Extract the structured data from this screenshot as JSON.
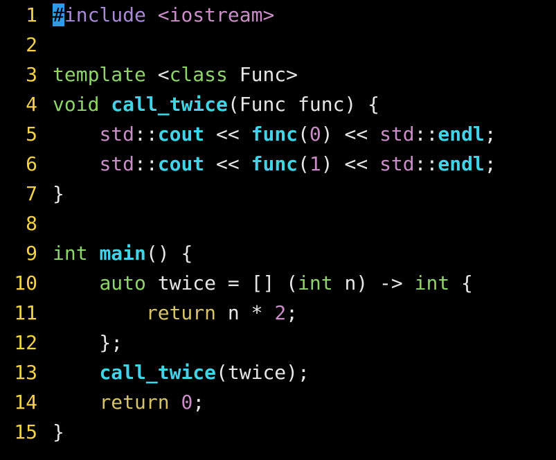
{
  "editor": {
    "lines": [
      {
        "number": "1",
        "tokens": [
          {
            "text": "#",
            "cls": "cursor"
          },
          {
            "text": "include",
            "cls": "pre"
          },
          {
            "text": " ",
            "cls": "punct"
          },
          {
            "text": "<iostream>",
            "cls": "str"
          }
        ]
      },
      {
        "number": "2",
        "tokens": []
      },
      {
        "number": "3",
        "tokens": [
          {
            "text": "template",
            "cls": "type"
          },
          {
            "text": " <",
            "cls": "punct"
          },
          {
            "text": "class",
            "cls": "type"
          },
          {
            "text": " Func>",
            "cls": "punct"
          }
        ]
      },
      {
        "number": "4",
        "tokens": [
          {
            "text": "void",
            "cls": "type"
          },
          {
            "text": " ",
            "cls": "punct"
          },
          {
            "text": "call_twice",
            "cls": "fn"
          },
          {
            "text": "(Func func) {",
            "cls": "punct"
          }
        ]
      },
      {
        "number": "5",
        "tokens": [
          {
            "text": "    ",
            "cls": "punct"
          },
          {
            "text": "std",
            "cls": "ns"
          },
          {
            "text": "::",
            "cls": "punct"
          },
          {
            "text": "cout",
            "cls": "fn"
          },
          {
            "text": " << ",
            "cls": "punct"
          },
          {
            "text": "func",
            "cls": "fn"
          },
          {
            "text": "(",
            "cls": "punct"
          },
          {
            "text": "0",
            "cls": "num"
          },
          {
            "text": ") << ",
            "cls": "punct"
          },
          {
            "text": "std",
            "cls": "ns"
          },
          {
            "text": "::",
            "cls": "punct"
          },
          {
            "text": "endl",
            "cls": "fn"
          },
          {
            "text": ";",
            "cls": "punct"
          }
        ]
      },
      {
        "number": "6",
        "tokens": [
          {
            "text": "    ",
            "cls": "punct"
          },
          {
            "text": "std",
            "cls": "ns"
          },
          {
            "text": "::",
            "cls": "punct"
          },
          {
            "text": "cout",
            "cls": "fn"
          },
          {
            "text": " << ",
            "cls": "punct"
          },
          {
            "text": "func",
            "cls": "fn"
          },
          {
            "text": "(",
            "cls": "punct"
          },
          {
            "text": "1",
            "cls": "num"
          },
          {
            "text": ") << ",
            "cls": "punct"
          },
          {
            "text": "std",
            "cls": "ns"
          },
          {
            "text": "::",
            "cls": "punct"
          },
          {
            "text": "endl",
            "cls": "fn"
          },
          {
            "text": ";",
            "cls": "punct"
          }
        ]
      },
      {
        "number": "7",
        "tokens": [
          {
            "text": "}",
            "cls": "punct"
          }
        ]
      },
      {
        "number": "8",
        "tokens": []
      },
      {
        "number": "9",
        "tokens": [
          {
            "text": "int",
            "cls": "type"
          },
          {
            "text": " ",
            "cls": "punct"
          },
          {
            "text": "main",
            "cls": "fn"
          },
          {
            "text": "() {",
            "cls": "punct"
          }
        ]
      },
      {
        "number": "10",
        "tokens": [
          {
            "text": "    ",
            "cls": "punct"
          },
          {
            "text": "auto",
            "cls": "type"
          },
          {
            "text": " twice = [] (",
            "cls": "punct"
          },
          {
            "text": "int",
            "cls": "type"
          },
          {
            "text": " n) -> ",
            "cls": "punct"
          },
          {
            "text": "int",
            "cls": "type"
          },
          {
            "text": " {",
            "cls": "punct"
          }
        ]
      },
      {
        "number": "11",
        "tokens": [
          {
            "text": "        ",
            "cls": "punct"
          },
          {
            "text": "return",
            "cls": "kw"
          },
          {
            "text": " n * ",
            "cls": "punct"
          },
          {
            "text": "2",
            "cls": "num"
          },
          {
            "text": ";",
            "cls": "punct"
          }
        ]
      },
      {
        "number": "12",
        "tokens": [
          {
            "text": "    };",
            "cls": "punct"
          }
        ]
      },
      {
        "number": "13",
        "tokens": [
          {
            "text": "    ",
            "cls": "punct"
          },
          {
            "text": "call_twice",
            "cls": "fn"
          },
          {
            "text": "(twice);",
            "cls": "punct"
          }
        ]
      },
      {
        "number": "14",
        "tokens": [
          {
            "text": "    ",
            "cls": "punct"
          },
          {
            "text": "return",
            "cls": "kw"
          },
          {
            "text": " ",
            "cls": "punct"
          },
          {
            "text": "0",
            "cls": "num"
          },
          {
            "text": ";",
            "cls": "punct"
          }
        ]
      },
      {
        "number": "15",
        "tokens": [
          {
            "text": "}",
            "cls": "punct"
          }
        ]
      }
    ]
  }
}
